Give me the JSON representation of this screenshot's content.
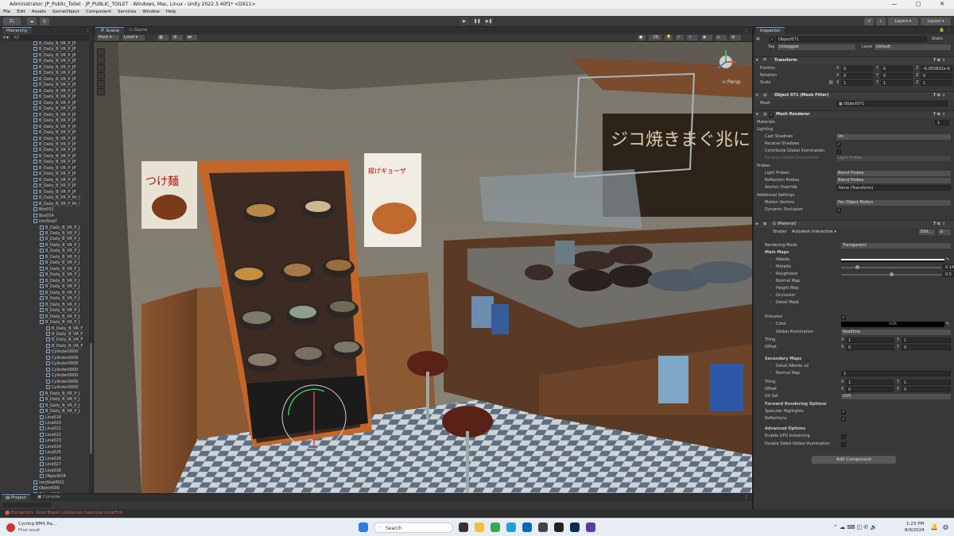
{
  "titlebar": {
    "title": "Administrator: JP_Public_Toilet - JP_PUBLIC_TOILET - Windows, Mac, Linux - Unity 2022.3.40f1* <DX11>"
  },
  "menu": [
    "File",
    "Edit",
    "Assets",
    "GameObject",
    "Component",
    "Services",
    "Window",
    "Help"
  ],
  "toolbar": {
    "account": "ZL",
    "layers": "Layers",
    "layout": "Layout"
  },
  "hierarchy": {
    "title": "Hierarchy",
    "search_placeholder": "All",
    "items": [
      {
        "label": "B_Daily_B_VR_P_JP",
        "indent": 1
      },
      {
        "label": "B_Daily_B_VR_P_JP",
        "indent": 1
      },
      {
        "label": "B_Daily_B_VR_P_JP",
        "indent": 1
      },
      {
        "label": "B_Daily_B_VR_P_JP",
        "indent": 1
      },
      {
        "label": "B_Daily_B_VR_P_JP",
        "indent": 1
      },
      {
        "label": "B_Daily_B_VR_P_JP",
        "indent": 1
      },
      {
        "label": "B_Daily_B_VR_P_JP",
        "indent": 1
      },
      {
        "label": "B_Daily_B_VR_P_JP",
        "indent": 1
      },
      {
        "label": "B_Daily_B_VR_P_JP",
        "indent": 1
      },
      {
        "label": "B_Daily_B_VR_P_JP",
        "indent": 1
      },
      {
        "label": "B_Daily_B_VR_P_JP",
        "indent": 1
      },
      {
        "label": "B_Daily_B_VR_P_JP",
        "indent": 1
      },
      {
        "label": "B_Daily_B_VR_P_JP",
        "indent": 1
      },
      {
        "label": "B_Daily_B_VR_P_JP",
        "indent": 1
      },
      {
        "label": "B_Daily_B_VR_P_JP",
        "indent": 1
      },
      {
        "label": "B_Daily_B_VR_P_JP",
        "indent": 1
      },
      {
        "label": "B_Daily_B_VR_P_JP",
        "indent": 1
      },
      {
        "label": "B_Daily_B_VR_P_JP",
        "indent": 1
      },
      {
        "label": "B_Daily_B_VR_P_JP",
        "indent": 1
      },
      {
        "label": "B_Daily_B_VR_P_JP",
        "indent": 1
      },
      {
        "label": "B_Daily_B_VR_P_JP",
        "indent": 1
      },
      {
        "label": "B_Daily_B_VR_P_JP",
        "indent": 1
      },
      {
        "label": "B_Daily_B_VR_P_JP",
        "indent": 1
      },
      {
        "label": "B_Daily_B_VR_P_JP",
        "indent": 1
      },
      {
        "label": "B_Daily_B_VR_P_JP",
        "indent": 1
      },
      {
        "label": "B_Daily_B_VR_P_JP",
        "indent": 1
      },
      {
        "label": "B_Daily_B_VR_P_Nr_I",
        "indent": 1
      },
      {
        "label": "B_Daily_B_VR_P_Nr_I",
        "indent": 1
      },
      {
        "label": "Box051",
        "indent": 1
      },
      {
        "label": "Box054",
        "indent": 1
      },
      {
        "label": "IronShelf",
        "indent": 1
      },
      {
        "label": "B_Daily_B_VR_P_J",
        "indent": 2
      },
      {
        "label": "B_Daily_B_VR_P_J",
        "indent": 2
      },
      {
        "label": "B_Daily_B_VR_P_J",
        "indent": 2
      },
      {
        "label": "B_Daily_B_VR_P_J",
        "indent": 2
      },
      {
        "label": "B_Daily_B_VR_P_J",
        "indent": 2
      },
      {
        "label": "B_Daily_B_VR_P_J",
        "indent": 2
      },
      {
        "label": "B_Daily_B_VR_P_J",
        "indent": 2
      },
      {
        "label": "B_Daily_B_VR_P_J",
        "indent": 2
      },
      {
        "label": "B_Daily_B_VR_P_J",
        "indent": 2
      },
      {
        "label": "B_Daily_B_VR_P_J",
        "indent": 2
      },
      {
        "label": "B_Daily_B_VR_P_J",
        "indent": 2
      },
      {
        "label": "B_Daily_B_VR_P_J",
        "indent": 2
      },
      {
        "label": "B_Daily_B_VR_P_J",
        "indent": 2
      },
      {
        "label": "B_Daily_B_VR_P_J",
        "indent": 2
      },
      {
        "label": "B_Daily_B_VR_P_J",
        "indent": 2
      },
      {
        "label": "B_Daily_B_VR_P_J",
        "indent": 2
      },
      {
        "label": "B_Daily_B_VR_P_J",
        "indent": 2
      },
      {
        "label": "B_Daily_B_VR_F",
        "indent": 3
      },
      {
        "label": "B_Daily_B_VR_F",
        "indent": 3
      },
      {
        "label": "B_Daily_B_VR_F",
        "indent": 3
      },
      {
        "label": "B_Daily_B_VR_F",
        "indent": 3
      },
      {
        "label": "Cylinder0000",
        "indent": 3
      },
      {
        "label": "Cylinder0000",
        "indent": 3
      },
      {
        "label": "Cylinder0000",
        "indent": 3
      },
      {
        "label": "Cylinder0000",
        "indent": 3
      },
      {
        "label": "Cylinder0000",
        "indent": 3
      },
      {
        "label": "Cylinder0000",
        "indent": 3
      },
      {
        "label": "Cylinder0000",
        "indent": 3
      },
      {
        "label": "B_Daily_B_VR_P_J",
        "indent": 2
      },
      {
        "label": "B_Daily_B_VR_P_J",
        "indent": 2
      },
      {
        "label": "B_Daily_B_VR_P_J",
        "indent": 2
      },
      {
        "label": "B_Daily_B_VR_P_J",
        "indent": 2
      },
      {
        "label": "Line018",
        "indent": 2
      },
      {
        "label": "Line020",
        "indent": 2
      },
      {
        "label": "Line021",
        "indent": 2
      },
      {
        "label": "Line022",
        "indent": 2
      },
      {
        "label": "Line023",
        "indent": 2
      },
      {
        "label": "Line024",
        "indent": 2
      },
      {
        "label": "Line025",
        "indent": 2
      },
      {
        "label": "Line026",
        "indent": 2
      },
      {
        "label": "Line027",
        "indent": 2
      },
      {
        "label": "Line028",
        "indent": 2
      },
      {
        "label": "Object034",
        "indent": 2
      },
      {
        "label": "IronShelf001",
        "indent": 1
      },
      {
        "label": "Object006",
        "indent": 1
      },
      {
        "label": "Object018",
        "indent": 1
      },
      {
        "label": "Object071",
        "indent": 2
      }
    ],
    "selected_index": 79
  },
  "scene": {
    "tabs": [
      "Scene",
      "Game"
    ],
    "pivot": "Pivot",
    "local": "Local",
    "mode_2d": "2D",
    "persp_label": "< Persp",
    "posters": [
      {
        "text": "つけ麺"
      },
      {
        "text": "揚げギョーザ"
      }
    ],
    "menu_board": "ジコ焼きまぐ兆にんとくにく"
  },
  "inspector": {
    "title": "Inspector",
    "object_name": "Object071",
    "static_label": "Static",
    "tag_label": "Tag",
    "tag_value": "Untagged",
    "layer_label": "Layer",
    "layer_value": "Default",
    "transform": {
      "title": "Transform",
      "position": {
        "label": "Position",
        "x": "0",
        "y": "0",
        "z": "-6.055832e-0"
      },
      "rotation": {
        "label": "Rotation",
        "x": "0",
        "y": "0",
        "z": "0"
      },
      "scale": {
        "label": "Scale",
        "x": "1",
        "y": "1",
        "z": "1"
      }
    },
    "mesh_filter": {
      "title": "Object 071 (Mesh Filter)",
      "mesh_label": "Mesh",
      "mesh_value": "Object071"
    },
    "mesh_renderer": {
      "title": "Mesh Renderer",
      "materials_label": "Materials",
      "materials_count": "1",
      "lighting_label": "Lighting",
      "cast_shadows_label": "Cast Shadows",
      "cast_shadows_value": "On",
      "receive_shadows_label": "Receive Shadows",
      "contribute_gi_label": "Contribute Global Illumination",
      "receive_gi_label": "Receive Global Illumination",
      "receive_gi_value": "Light Probes",
      "probes_label": "Probes",
      "light_probes_label": "Light Probes",
      "light_probes_value": "Blend Probes",
      "reflection_probes_label": "Reflection Probes",
      "reflection_probes_value": "Blend Probes",
      "anchor_override_label": "Anchor Override",
      "anchor_override_value": "None (Transform)",
      "additional_label": "Additional Settings",
      "motion_vectors_label": "Motion Vectors",
      "motion_vectors_value": "Per Object Motion",
      "dynamic_occlusion_label": "Dynamic Occlusion"
    },
    "material": {
      "title": "G (Material)",
      "shader_label": "Shader",
      "shader_value": "Autodesk Interactive",
      "edit_label": "Edit...",
      "rendering_mode_label": "Rendering Mode",
      "rendering_mode_value": "Transparent",
      "main_maps_label": "Main Maps",
      "albedo_label": "Albedo",
      "metallic_label": "Metallic",
      "metallic_value": "0.148",
      "metallic_level": 0.148,
      "roughness_label": "Roughness",
      "roughness_value": "0.5",
      "roughness_level": 0.5,
      "normal_label": "Normal Map",
      "height_label": "Height Map",
      "occlusion_label": "Occlusion",
      "detail_mask_label": "Detail Mask",
      "emission_label": "Emission",
      "color_label": "Color",
      "color_value": "HDR",
      "gi_label": "Global Illumination",
      "gi_value": "Realtime",
      "tiling_label": "Tiling",
      "tiling_x": "1",
      "tiling_y": "1",
      "offset_label": "Offset",
      "offset_x": "0",
      "offset_y": "0",
      "secondary_label": "Secondary Maps",
      "detail_albedo_label": "Detail Albedo x2",
      "sec_normal_label": "Normal Map",
      "sec_normal_value": "1",
      "sec_tiling_label": "Tiling",
      "sec_tiling_x": "1",
      "sec_tiling_y": "1",
      "sec_offset_label": "Offset",
      "sec_offset_x": "0",
      "sec_offset_y": "0",
      "uvset_label": "UV Set",
      "uvset_value": "UV0",
      "forward_label": "Forward Rendering Options",
      "specular_label": "Specular Highlights",
      "reflections_label": "Reflections",
      "advanced_label": "Advanced Options",
      "gpu_label": "Enable GPU Instancing",
      "dsgi_label": "Double Sided Global Illumination"
    },
    "add_component": "Add Component"
  },
  "bottom": {
    "project_tab": "Project",
    "console_tab": "Console"
  },
  "status": {
    "error": "Exception: Xxxx.Bepin.ListGroup.hasmore.LookFrm"
  },
  "taskbar": {
    "app_title": "Cycling BMX Ra...",
    "app_sub": "Final result",
    "search": "Search",
    "time": "1:23 PM",
    "date": "8/9/2024"
  },
  "colors": {
    "accent": "#2c5d87",
    "panel": "#383838",
    "error": "#e05a5a"
  }
}
